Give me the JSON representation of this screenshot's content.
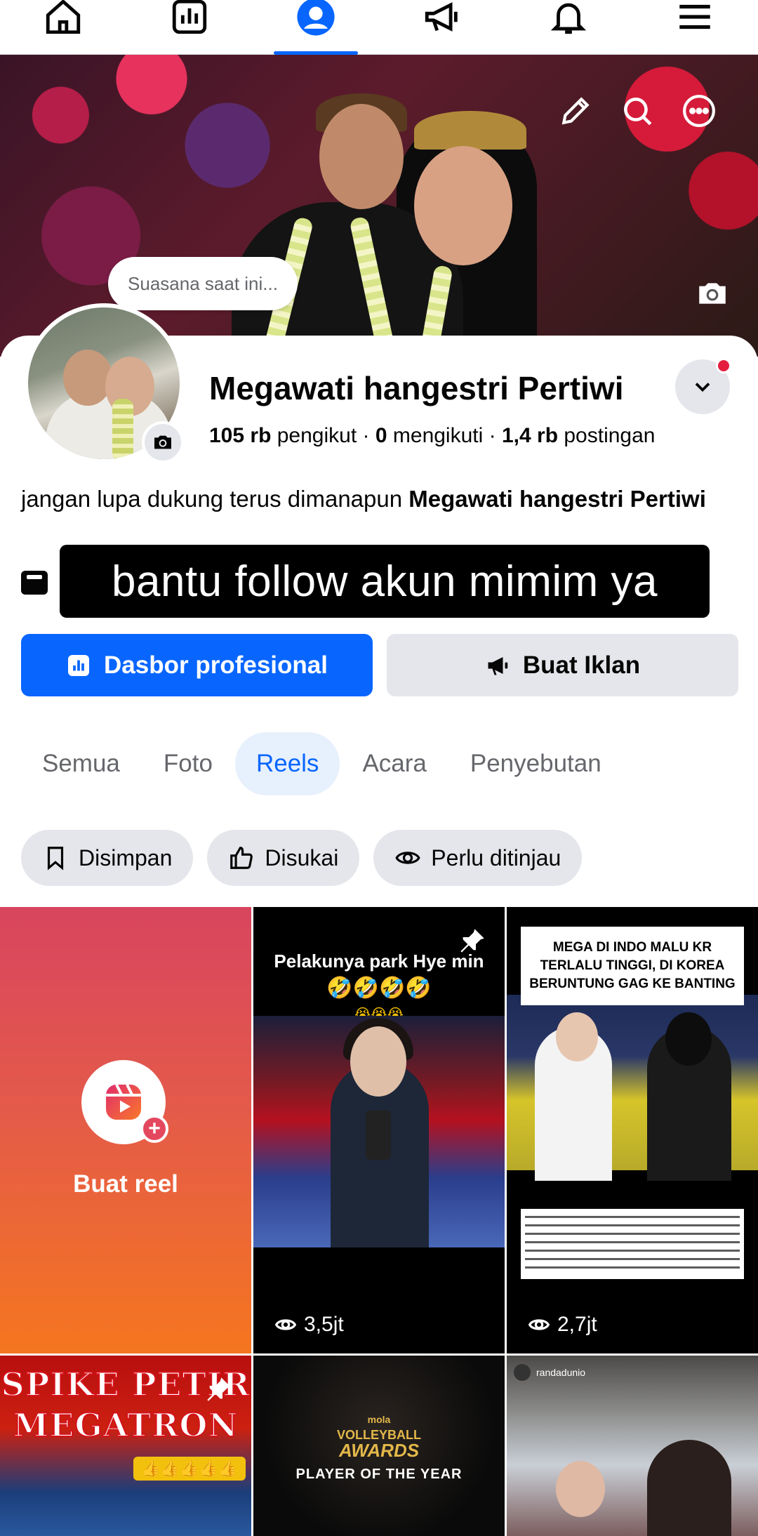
{
  "nav": {
    "items": [
      {
        "icon": "home-icon",
        "active": false
      },
      {
        "icon": "dashboard-icon",
        "active": false
      },
      {
        "icon": "profile-icon",
        "active": true
      },
      {
        "icon": "megaphone-icon",
        "active": false
      },
      {
        "icon": "bell-icon",
        "active": false
      },
      {
        "icon": "menu-icon",
        "active": false
      }
    ],
    "accent_color": "#0866ff"
  },
  "cover": {
    "mood_placeholder": "Suasana saat ini...",
    "icons": [
      "edit-icon",
      "search-icon",
      "more-icon",
      "camera-icon"
    ]
  },
  "profile": {
    "name": "Megawati hangestri Pertiwi",
    "followers_count": "105 rb",
    "followers_label": "pengikut",
    "following_count": "0",
    "following_label": "mengikuti",
    "posts_count": "1,4 rb",
    "posts_label": "postingan",
    "separator": "·",
    "bio_text": "jangan lupa dukung terus dimanapun",
    "bio_bold": "Megawati hangestri Pertiwi"
  },
  "overlay_caption": "bantu follow akun mimim ya",
  "actions": {
    "primary_label": "Dasbor profesional",
    "secondary_label": "Buat Iklan",
    "primary_color": "#0866ff"
  },
  "tabs": [
    {
      "label": "Semua",
      "active": false
    },
    {
      "label": "Foto",
      "active": false
    },
    {
      "label": "Reels",
      "active": true
    },
    {
      "label": "Acara",
      "active": false
    },
    {
      "label": "Penyebutan",
      "active": false
    }
  ],
  "filters": [
    {
      "label": "Disimpan",
      "icon": "bookmark-icon"
    },
    {
      "label": "Disukai",
      "icon": "thumbs-up-icon"
    },
    {
      "label": "Perlu ditinjau",
      "icon": "eye-icon"
    }
  ],
  "reels": {
    "create_label": "Buat reel",
    "items": [
      {
        "caption_line1": "Pelakunya park Hye min",
        "caption_line2": "🤣🤣🤣🤣",
        "caption_line3": "😭😭😭",
        "views": "3,5jt",
        "pinned": true
      },
      {
        "caption_line1": "MEGA DI INDO MALU KR",
        "caption_line2": "TERLALU TINGGI, DI KOREA",
        "caption_line3": "BERUNTUNG GAG KE BANTING",
        "views": "2,7jt",
        "pinned": true
      }
    ],
    "bottom": [
      {
        "line1": "SPIKE PETIR",
        "line2": "MEGATRON",
        "emoji": "👍👍👍👍👍"
      },
      {
        "logo_small": "mola",
        "logo_line1": "VOLLEYBALL",
        "logo_line2": "AWARDS",
        "subtitle": "PLAYER OF THE YEAR"
      },
      {
        "username": "randadunio"
      }
    ]
  }
}
